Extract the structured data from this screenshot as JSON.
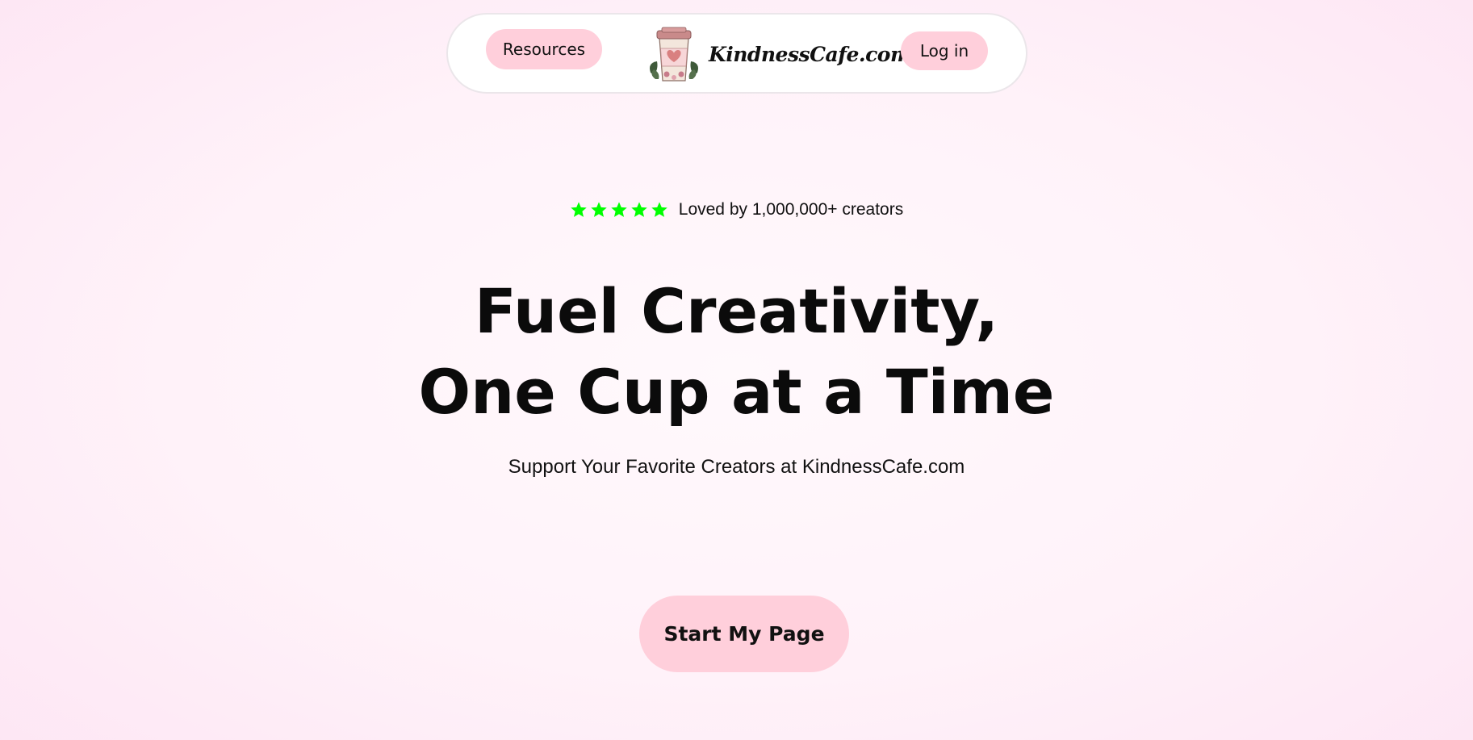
{
  "nav": {
    "resources_label": "Resources",
    "logo_text": "KindnessCafe.com",
    "login_label": "Log in"
  },
  "hero": {
    "rating": {
      "stars": 5,
      "star_color": "#00ff00",
      "text": "Loved by 1,000,000+ creators"
    },
    "title_line1": "Fuel Creativity,",
    "title_line2": "One Cup at a Time",
    "subtitle": "Support Your Favorite Creators at KindnessCafe.com",
    "cta_label": "Start My Page"
  },
  "icons": {
    "logo": "coffee-cup-heart-icon",
    "star": "star-icon"
  },
  "colors": {
    "button_pink": "#ffcfdb",
    "background_pink": "#fde6f4",
    "text": "#111111"
  }
}
